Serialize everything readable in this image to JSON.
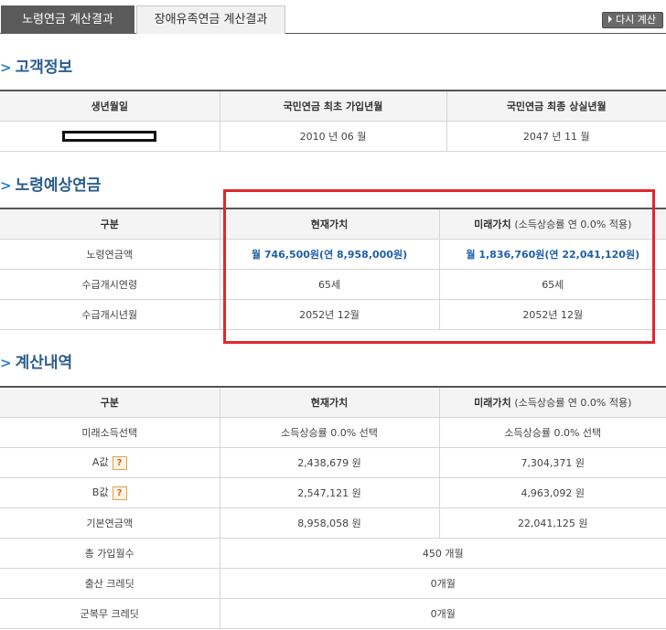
{
  "tabs": {
    "active": "노령연금 계산결과",
    "inactive": "장애유족연금 계산결과"
  },
  "recalc_label": "다시 계산",
  "customer": {
    "title": "고객정보",
    "headers": [
      "생년월일",
      "국민연금 최초 가입년월",
      "국민연금 최종 상실년월"
    ],
    "values": [
      "",
      "2010 년 06 월",
      "2047 년 11 월"
    ]
  },
  "pension": {
    "title": "노령예상연금",
    "headers": {
      "col1": "구분",
      "col2": "현재가치",
      "col3_main": "미래가치",
      "col3_sub": "(소득상승률 연 0.0% 적용)"
    },
    "rows": [
      {
        "label": "노령연금액",
        "present": "월 746,500원(연 8,958,000원)",
        "future": "월 1,836,760원(연 22,041,120원)"
      },
      {
        "label": "수급개시연령",
        "present": "65세",
        "future": "65세"
      },
      {
        "label": "수급개시년월",
        "present": "2052년 12월",
        "future": "2052년 12월"
      }
    ]
  },
  "calc": {
    "title": "계산내역",
    "headers": {
      "col1": "구분",
      "col2": "현재가치",
      "col3_main": "미래가치",
      "col3_sub": "(소득상승률 연 0.0% 적용)"
    },
    "rows": [
      {
        "label": "미래소득선택",
        "present": "소득상승률 0.0% 선택",
        "future": "소득상승률 0.0% 선택"
      },
      {
        "label": "A값",
        "present": "2,438,679 원",
        "future": "7,304,371 원"
      },
      {
        "label": "B값",
        "present": "2,547,121 원",
        "future": "4,963,092 원"
      },
      {
        "label": "기본연금액",
        "present": "8,958,058 원",
        "future": "22,041,125 원"
      },
      {
        "label": "총 가입월수",
        "value": "450 개월"
      },
      {
        "label": "출산 크레딧",
        "value": "0개월"
      },
      {
        "label": "군복무 크레딧",
        "value": "0개월"
      }
    ],
    "help_icon": "?"
  },
  "colors": {
    "accent_blue": "#1f5fa8",
    "section_title": "#2a5d8e",
    "highlight_red": "#e0282e"
  },
  "icons": {
    "section_chevron": "chevron-right-icon",
    "recalc_arrow": "triangle-right-icon",
    "help": "question-icon"
  }
}
